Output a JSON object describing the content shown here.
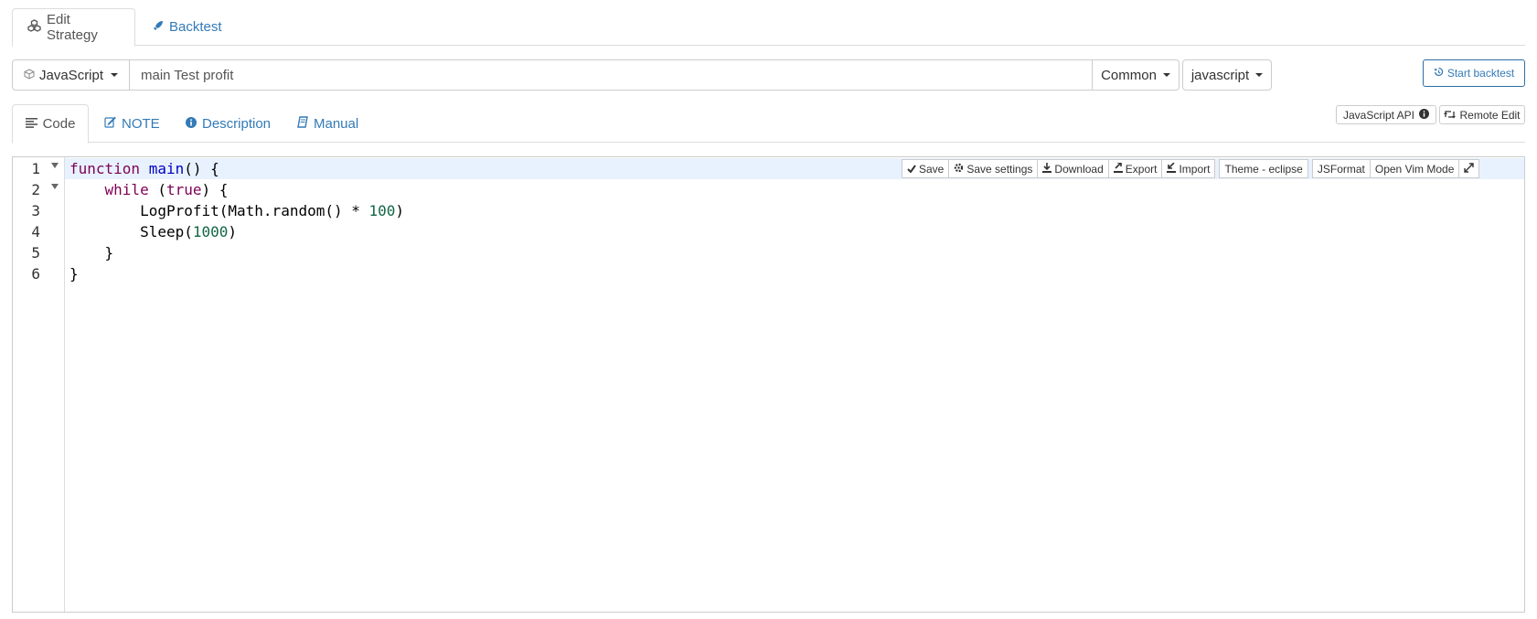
{
  "top_tabs": {
    "edit_strategy": "Edit Strategy",
    "backtest": "Backtest"
  },
  "strategy_bar": {
    "language": "JavaScript",
    "name_value": "main Test profit",
    "category": "Common",
    "syntax": "javascript",
    "start_backtest": "Start backtest"
  },
  "sub_tabs": {
    "code": "Code",
    "note": "NOTE",
    "description": "Description",
    "manual": "Manual"
  },
  "right_buttons": {
    "api": "JavaScript API",
    "remote_edit": "Remote Edit"
  },
  "editor": {
    "line_numbers": [
      "1",
      "2",
      "3",
      "4",
      "5",
      "6"
    ],
    "toolbar": {
      "save": "Save",
      "save_settings": "Save settings",
      "download": "Download",
      "export": "Export",
      "import": "Import",
      "theme": "Theme - eclipse",
      "jsformat": "JSFormat",
      "vim": "Open Vim Mode"
    },
    "code": {
      "l1_kw": "function",
      "l1_fn": "main",
      "l1_rest": "() {",
      "l2_kw": "while",
      "l2_rest1": " (",
      "l2_true": "true",
      "l2_rest2": ") {",
      "l3_call": "LogProfit(Math.random() * ",
      "l3_num": "100",
      "l3_end": ")",
      "l4_call": "Sleep(",
      "l4_num": "1000",
      "l4_end": ")",
      "l5": "}",
      "l6": "}"
    }
  },
  "colors": {
    "accent": "#337ab7",
    "active_line": "#e8f2fe",
    "keyword": "#7f0055"
  }
}
